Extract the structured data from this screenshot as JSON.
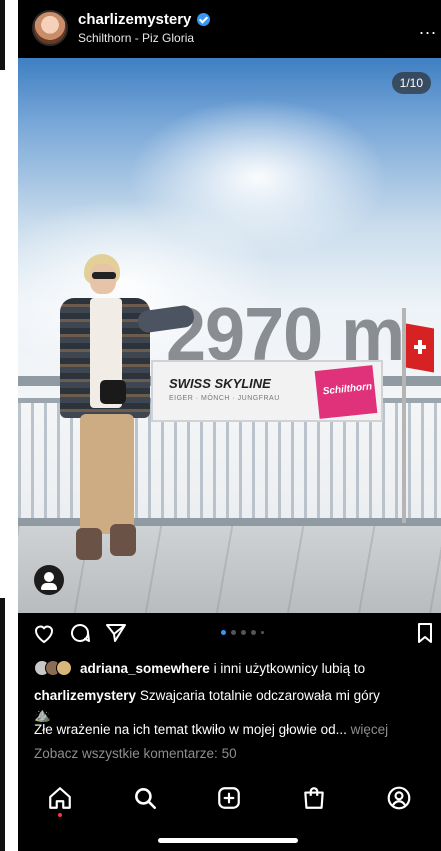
{
  "header": {
    "username": "charlizemystery",
    "location": "Schilthorn - Piz Gloria",
    "more_label": "..."
  },
  "image": {
    "counter": "1/10",
    "altitude_text": "2970 m",
    "sign_title": "SWISS SKYLINE",
    "sign_subtitle": "EIGER · MÖNCH · JUNGFRAU",
    "sign_logo": "Schilthorn"
  },
  "carousel": {
    "total_dots": 5,
    "active_index": 0
  },
  "likes": {
    "user": "adriana_somewhere",
    "rest": " i inni użytkownicy lubią to"
  },
  "caption": {
    "username": "charlizemystery",
    "line1": " Szwajcaria totalnie odczarowała mi góry",
    "emoji": "⛰️",
    "line2": "Złe wrażenie na ich temat tkwiło w mojej głowie od...",
    "more": " więcej"
  },
  "comments_link": "Zobacz wszystkie komentarze: 50",
  "nav": {
    "items": [
      "home-icon",
      "search-icon",
      "new-post-icon",
      "shop-icon",
      "profile-icon"
    ]
  },
  "colors": {
    "accent": "#3897f0",
    "notification": "#ff3040",
    "brand_pink": "#e0327a"
  }
}
